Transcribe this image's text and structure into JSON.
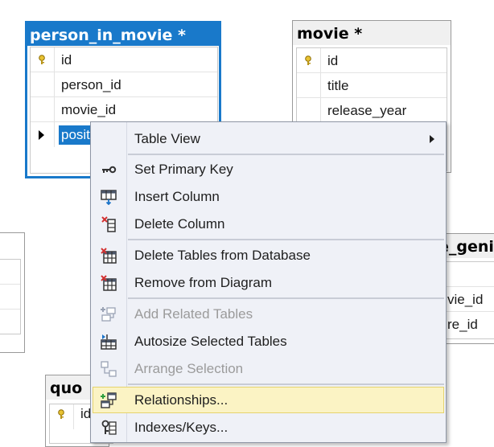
{
  "tables": {
    "person_in_movie": {
      "title": "person_in_movie *",
      "columns": [
        "id",
        "person_id",
        "movie_id",
        "posit"
      ]
    },
    "movie": {
      "title": "movie *",
      "columns": [
        "id",
        "title",
        "release_year"
      ]
    },
    "movie_genre": {
      "title_fragment": "e_geni",
      "columns": [
        "vie_id",
        "re_id"
      ]
    },
    "quote": {
      "title_fragment": "quo",
      "columns": [
        "id"
      ]
    }
  },
  "context_menu": {
    "items": [
      {
        "label": "Table View",
        "icon": "table-view-icon",
        "submenu": true,
        "enabled": true
      },
      {
        "label": "Set Primary Key",
        "icon": "primary-key-icon",
        "enabled": true
      },
      {
        "label": "Insert Column",
        "icon": "insert-column-icon",
        "enabled": true
      },
      {
        "label": "Delete Column",
        "icon": "delete-column-icon",
        "enabled": true
      },
      {
        "label": "Delete Tables from Database",
        "icon": "delete-tables-icon",
        "enabled": true
      },
      {
        "label": "Remove from Diagram",
        "icon": "remove-from-diagram-icon",
        "enabled": true
      },
      {
        "label": "Add Related Tables",
        "icon": "add-related-tables-icon",
        "enabled": false
      },
      {
        "label": "Autosize Selected Tables",
        "icon": "autosize-tables-icon",
        "enabled": true
      },
      {
        "label": "Arrange Selection",
        "icon": "arrange-selection-icon",
        "enabled": false
      },
      {
        "label": "Relationships...",
        "icon": "relationships-icon",
        "enabled": true,
        "highlighted": true
      },
      {
        "label": "Indexes/Keys...",
        "icon": "indexes-keys-icon",
        "enabled": true
      }
    ]
  },
  "colors": {
    "selection": "#1979ca",
    "menu_background": "#eff1f7",
    "menu_highlight": "#fbf3c4",
    "delete_red": "#d32f2f"
  }
}
